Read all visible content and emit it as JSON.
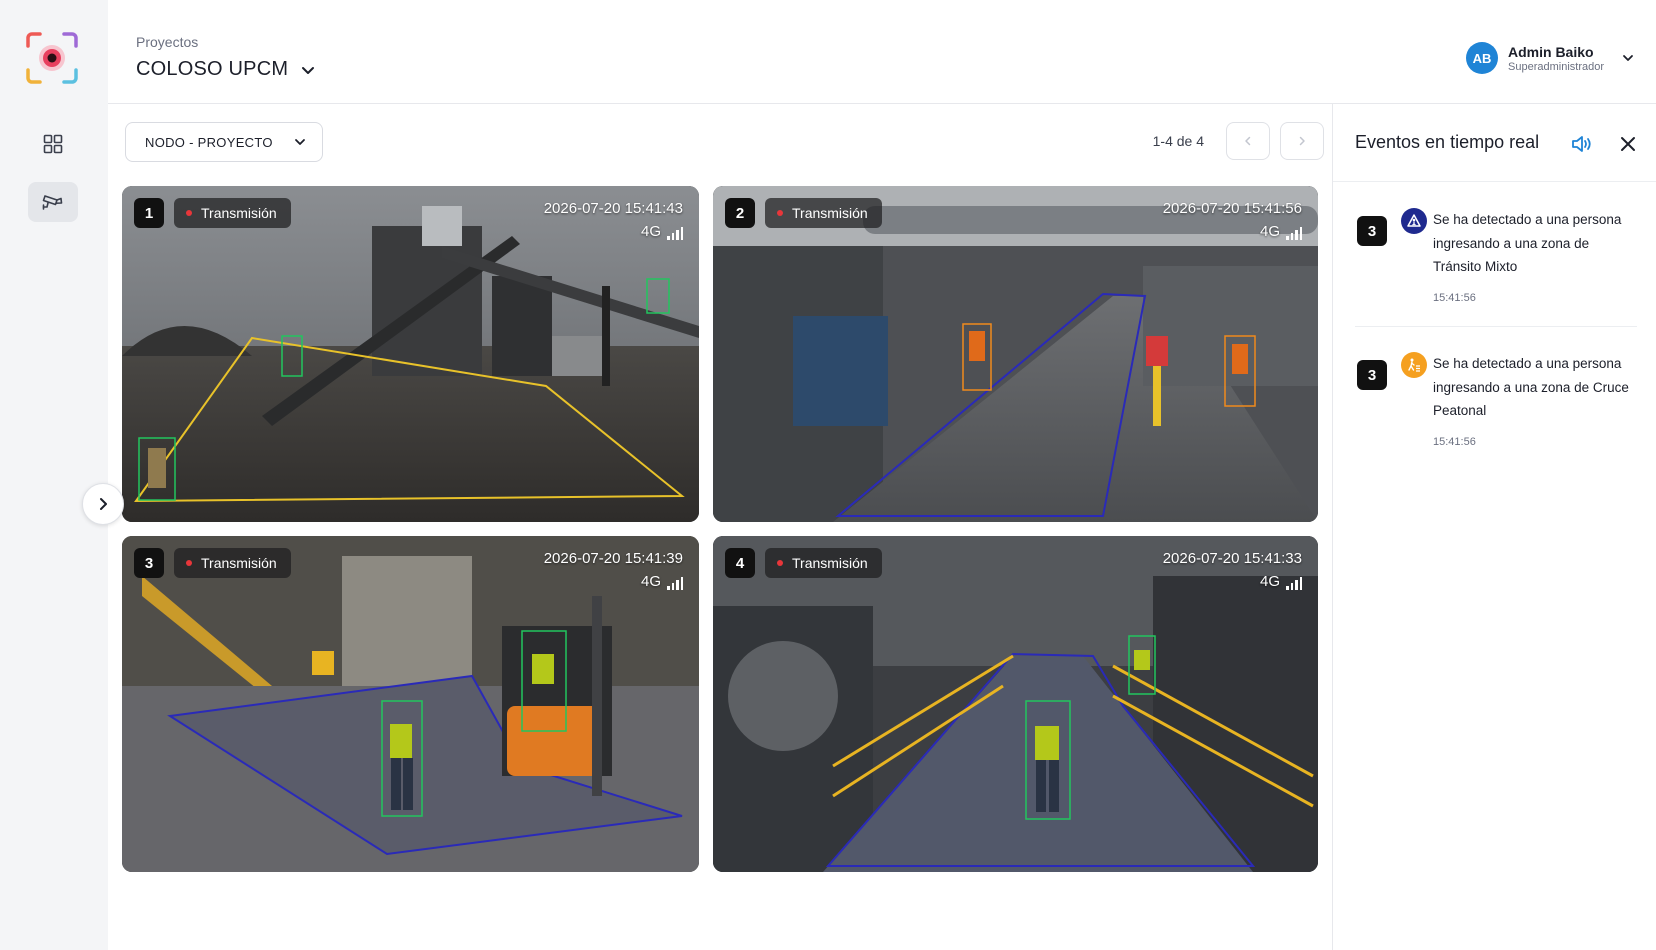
{
  "header": {
    "projects_label": "Proyectos",
    "project_name": "COLOSO UPCM",
    "user": {
      "initials": "AB",
      "name": "Admin Baiko",
      "role": "Superadministrador"
    }
  },
  "nav": {
    "items": [
      {
        "name": "dashboard",
        "icon": "grid-icon",
        "active": false
      },
      {
        "name": "cameras",
        "icon": "cctv-camera-icon",
        "active": true
      }
    ]
  },
  "toolbar": {
    "node_filter": "NODO - PROYECTO",
    "pagination": "1-4 de 4"
  },
  "cameras": [
    {
      "number": "1",
      "status": "Transmisión",
      "timestamp": "2026-07-20 15:41:43",
      "network": "4G",
      "zone_color": "#e8c22a"
    },
    {
      "number": "2",
      "status": "Transmisión",
      "timestamp": "2026-07-20 15:41:56",
      "network": "4G",
      "zone_color": "#2a2ab8"
    },
    {
      "number": "3",
      "status": "Transmisión",
      "timestamp": "2026-07-20 15:41:39",
      "network": "4G",
      "zone_color": "#2a2ab8"
    },
    {
      "number": "4",
      "status": "Transmisión",
      "timestamp": "2026-07-20 15:41:33",
      "network": "4G",
      "zone_color": "#2a2ab8"
    }
  ],
  "events_panel": {
    "title": "Eventos en tiempo real",
    "events": [
      {
        "camera": "3",
        "icon": "mixed-transit-icon",
        "icon_color": "#1f2a8f",
        "message": "Se ha detectado a una persona ingresando a una zona de Tránsito Mixto",
        "time": "15:41:56"
      },
      {
        "camera": "3",
        "icon": "pedestrian-crossing-icon",
        "icon_color": "#f5a020",
        "message": "Se ha detectado a una persona ingresando a una zona de Cruce Peatonal",
        "time": "15:41:56"
      }
    ]
  },
  "colors": {
    "accent_blue": "#1f84d6",
    "live_dot": "#e8363a",
    "detection_box": "#22c55e",
    "detection_box_alert": "#f08a1c"
  }
}
